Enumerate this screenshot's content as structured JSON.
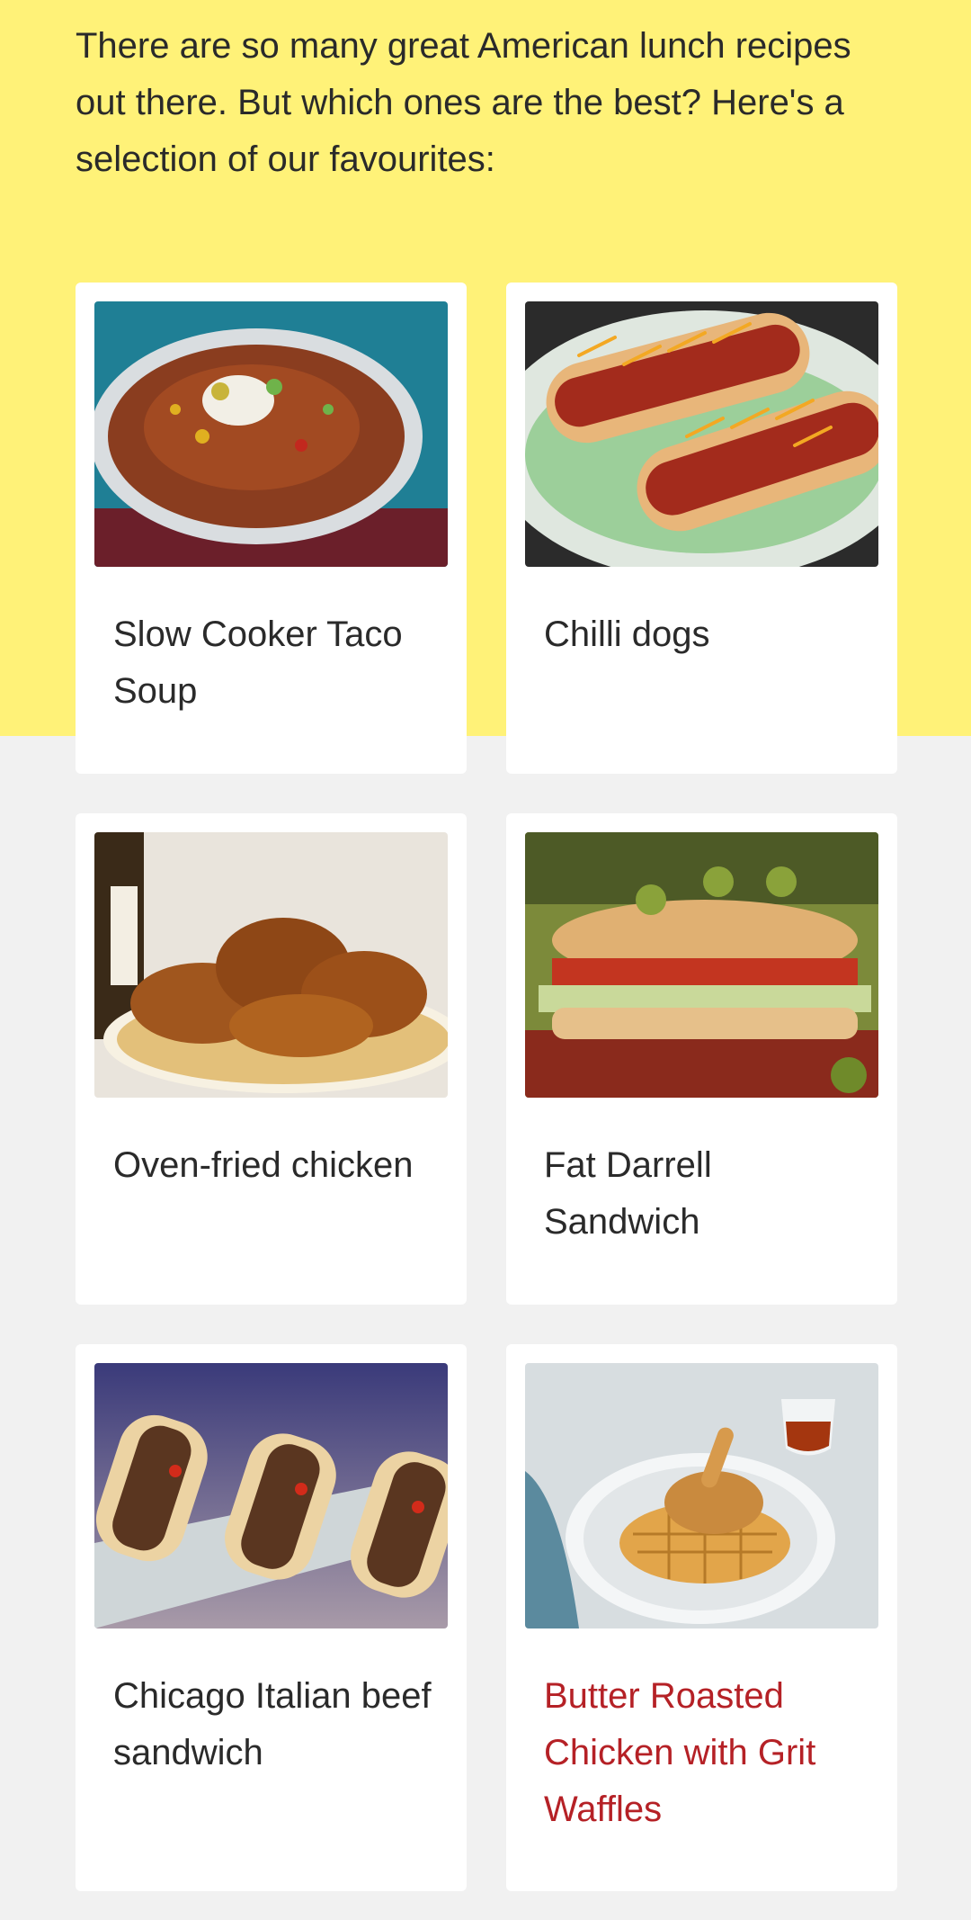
{
  "intro": "There are so many great American lunch recipes out there. But which ones are the best? Here's a selection of our favourites:",
  "colors": {
    "band": "#fff278",
    "page": "#f1f1f1",
    "card": "#ffffff",
    "highlight": "#b52126"
  },
  "recipes": [
    {
      "title": "Slow Cooker Taco Soup",
      "image": "taco-soup-photo"
    },
    {
      "title": "Chilli dogs",
      "image": "chilli-dogs-photo"
    },
    {
      "title": "Oven-fried chicken",
      "image": "fried-chicken-photo"
    },
    {
      "title": "Fat Darrell Sandwich",
      "image": "sub-sandwich-photo"
    },
    {
      "title": "Chicago Italian beef sandwich",
      "image": "beef-sandwich-photo"
    },
    {
      "title": "Butter Roasted Chicken with Grit Waffles",
      "image": "chicken-waffle-photo",
      "highlighted": true
    }
  ]
}
